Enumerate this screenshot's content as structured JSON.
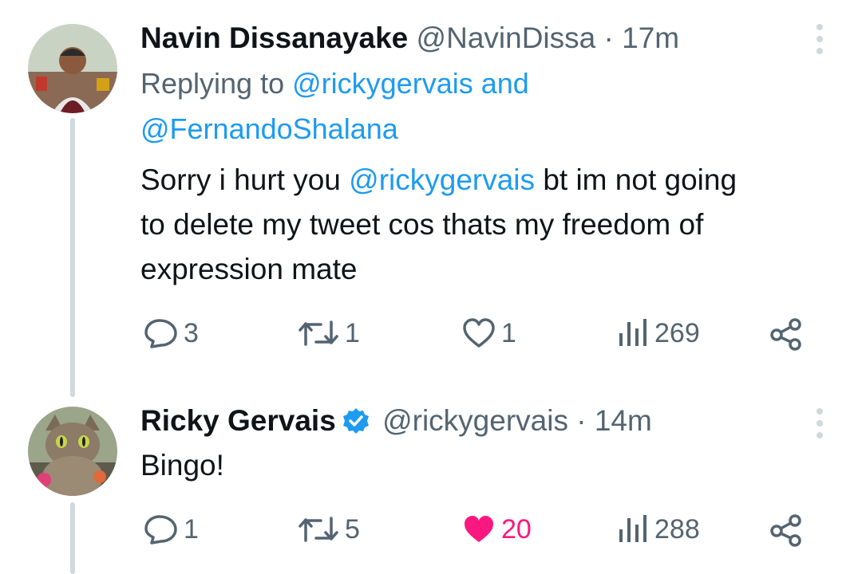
{
  "colors": {
    "link": "#1d9bf0",
    "muted": "#536471",
    "like": "#f91880",
    "thread_line": "#cfd9de"
  },
  "tweets": [
    {
      "name": "Navin Dissanayake",
      "handle": "@NavinDissa",
      "time": "· 17m",
      "replying_prefix": "Replying to",
      "replying_user1": "@rickygervais",
      "replying_and": "and",
      "replying_user2": "@FernandoShalana",
      "text_part1": "Sorry i hurt you",
      "text_mention": "@rickygervais",
      "text_part2": "bt im not going",
      "text_line2": "to delete my tweet cos thats my freedom of",
      "text_line3": "expression mate",
      "replies": "3",
      "retweets": "1",
      "likes": "1",
      "views": "269",
      "liked": false
    },
    {
      "name": "Ricky Gervais",
      "handle": "@rickygervais",
      "time": "· 14m",
      "verified": true,
      "text": "Bingo!",
      "replies": "1",
      "retweets": "5",
      "likes": "20",
      "views": "288",
      "liked": true
    }
  ]
}
